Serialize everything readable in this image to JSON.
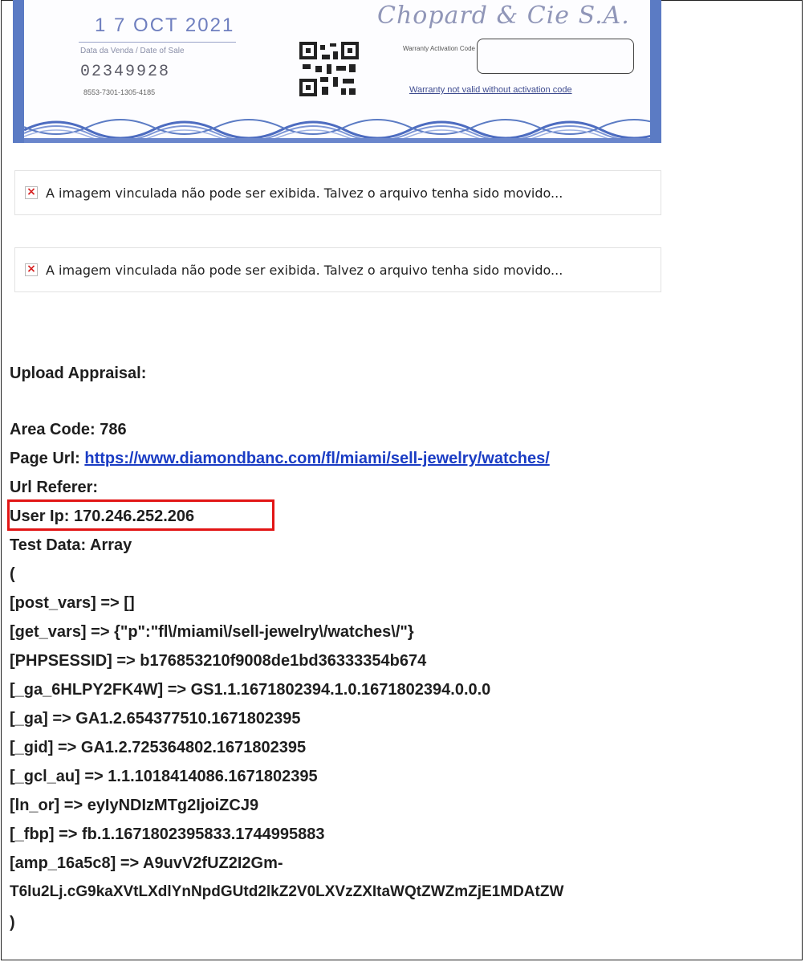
{
  "card": {
    "date": "1 7 OCT 2021",
    "date_label": "Data da Venda / Date of Sale",
    "serial": "02349928",
    "reference": "8553-7301-1305-4185",
    "brand": "Chopard & Cie S.A.",
    "activation_label": "Warranty Activation Code",
    "warranty_note": "Warranty not valid without activation code",
    "accent_color": "#5b7bc4"
  },
  "broken_images": [
    {
      "message": "A imagem vinculada não pode ser exibida. Talvez o arquivo tenha sido movido..."
    },
    {
      "message": "A imagem vinculada não pode ser exibida. Talvez o arquivo tenha sido movido..."
    }
  ],
  "upload_heading": "Upload Appraisal:",
  "area_code": "Area Code: 786",
  "page_url_label": "Page Url: ",
  "page_url": "https://www.diamondbanc.com/fl/miami/sell-jewelry/watches/",
  "url_referer": "Url Referer:",
  "user_ip": "User Ip: 170.246.252.206",
  "test_data": "Test Data: Array",
  "array_lines": [
    "(",
    "[post_vars] => []",
    "[get_vars] => {\"p\":\"fl\\/miami\\/sell-jewelry\\/watches\\/\"}",
    "[PHPSESSID] => b176853210f9008de1bd36333354b674",
    "[_ga_6HLPY2FK4W] => GS1.1.1671802394.1.0.1671802394.0.0.0",
    "[_ga] => GA1.2.654377510.1671802395",
    "[_gid] => GA1.2.725364802.1671802395",
    "[_gcl_au] => 1.1.1018414086.1671802395",
    "[ln_or] => eyIyNDIzMTg2IjoiZCJ9",
    "[_fbp] => fb.1.1671802395833.1744995883",
    "[amp_16a5c8] => A9uvV2fUZ2I2Gm-",
    "T6lu2Lj.cG9kaXVtLXdlYnNpdGUtd2lkZ2V0LXVzZXItaWQtZWZmZjE1MDAtZW",
    ")"
  ]
}
